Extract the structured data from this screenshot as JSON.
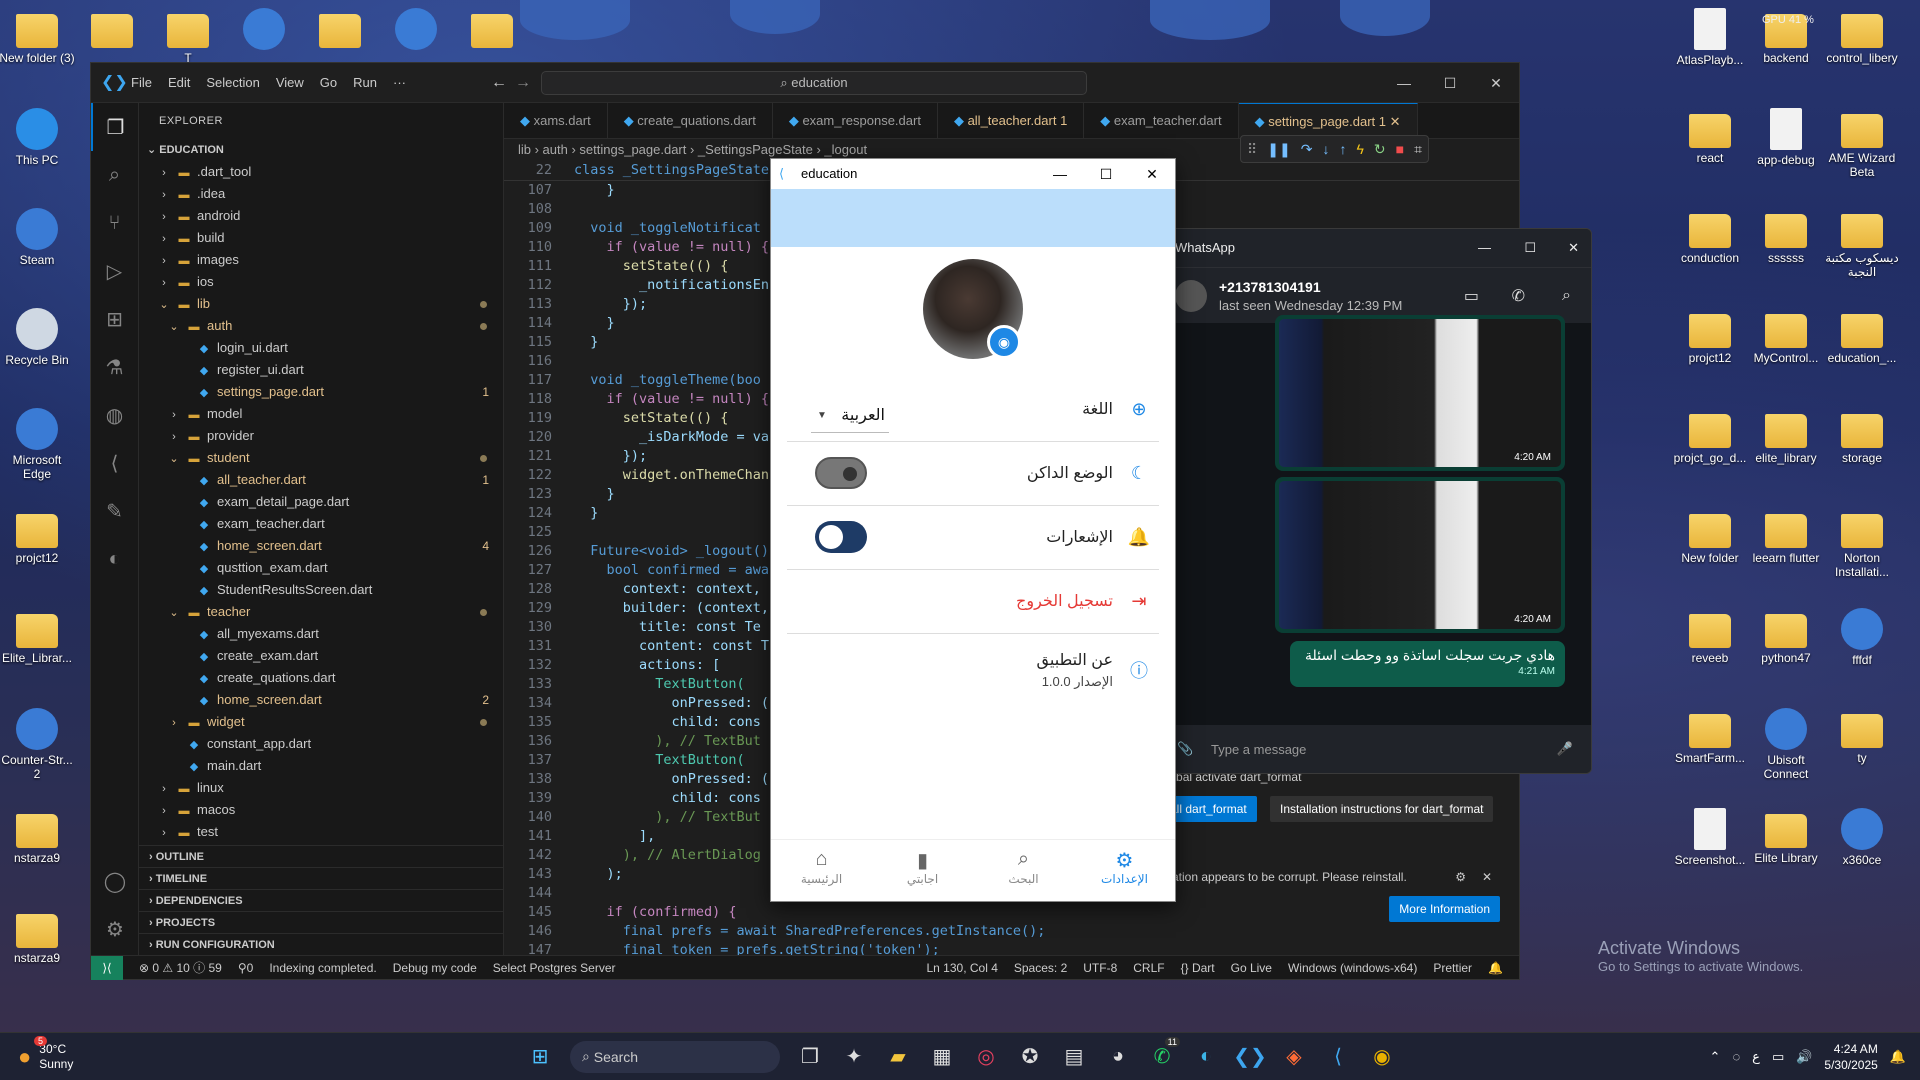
{
  "desktop": {
    "left_icons": [
      {
        "label": "New folder (3)",
        "type": "folder"
      },
      {
        "label": "This PC",
        "type": "pc"
      },
      {
        "label": "Steam",
        "type": "app"
      },
      {
        "label": "Recycle Bin",
        "type": "bin"
      },
      {
        "label": "Microsoft Edge",
        "type": "app"
      },
      {
        "label": "projct12",
        "type": "folder"
      },
      {
        "label": "Elite_Librar...",
        "type": "folder"
      },
      {
        "label": "Counter-Str... 2",
        "type": "app"
      },
      {
        "label": "nstarza9",
        "type": "folder"
      },
      {
        "label": "nstarza9",
        "type": "folder"
      }
    ],
    "top_icons": [
      {
        "label": "",
        "type": "folder"
      },
      {
        "label": "T",
        "type": "folder"
      },
      {
        "label": "",
        "type": "app"
      },
      {
        "label": "",
        "type": "folder"
      },
      {
        "label": "",
        "type": "app"
      },
      {
        "label": "",
        "type": "folder"
      }
    ],
    "right_icons": [
      {
        "label": "AtlasPlayb...",
        "type": "file"
      },
      {
        "label": "backend",
        "type": "folder"
      },
      {
        "label": "control_libery",
        "type": "folder"
      },
      {
        "label": "react",
        "type": "folder"
      },
      {
        "label": "app-debug",
        "type": "file"
      },
      {
        "label": "AME Wizard Beta",
        "type": "folder"
      },
      {
        "label": "conduction",
        "type": "folder"
      },
      {
        "label": "ssssss",
        "type": "folder"
      },
      {
        "label": "ديسكوب مكتبة النجبة",
        "type": "folder"
      },
      {
        "label": "projct12",
        "type": "folder"
      },
      {
        "label": "MyControl...",
        "type": "folder"
      },
      {
        "label": "education_...",
        "type": "folder"
      },
      {
        "label": "projct_go_d...",
        "type": "folder"
      },
      {
        "label": "elite_library",
        "type": "folder"
      },
      {
        "label": "storage",
        "type": "folder"
      },
      {
        "label": "New folder",
        "type": "folder"
      },
      {
        "label": "leearn flutter",
        "type": "folder"
      },
      {
        "label": "Norton Installati...",
        "type": "folder"
      },
      {
        "label": "reveeb",
        "type": "folder"
      },
      {
        "label": "python47",
        "type": "folder"
      },
      {
        "label": "fffdf",
        "type": "app"
      },
      {
        "label": "SmartFarm...",
        "type": "folder"
      },
      {
        "label": "Ubisoft Connect",
        "type": "app"
      },
      {
        "label": "ty",
        "type": "folder"
      },
      {
        "label": "Screenshot...",
        "type": "file"
      },
      {
        "label": "Elite Library",
        "type": "folder"
      },
      {
        "label": "x360ce",
        "type": "app"
      }
    ],
    "gpu": "GPU 41 %"
  },
  "vscode": {
    "menu": [
      "File",
      "Edit",
      "Selection",
      "View",
      "Go",
      "Run",
      "···"
    ],
    "search": "education",
    "explorer_title": "EXPLORER",
    "project": "EDUCATION",
    "tree": [
      {
        "label": ".dart_tool",
        "d": 1,
        "kind": "folder"
      },
      {
        "label": ".idea",
        "d": 1,
        "kind": "folder"
      },
      {
        "label": "android",
        "d": 1,
        "kind": "folder"
      },
      {
        "label": "build",
        "d": 1,
        "kind": "folder"
      },
      {
        "label": "images",
        "d": 1,
        "kind": "folder"
      },
      {
        "label": "ios",
        "d": 1,
        "kind": "folder"
      },
      {
        "label": "lib",
        "d": 1,
        "kind": "folder-open",
        "mod": true,
        "dot": true
      },
      {
        "label": "auth",
        "d": 2,
        "kind": "folder-open",
        "mod": true,
        "dot": true
      },
      {
        "label": "login_ui.dart",
        "d": 3,
        "kind": "dart"
      },
      {
        "label": "register_ui.dart",
        "d": 3,
        "kind": "dart"
      },
      {
        "label": "settings_page.dart",
        "d": 3,
        "kind": "dart",
        "mod": true,
        "badge": "1"
      },
      {
        "label": "model",
        "d": 2,
        "kind": "folder"
      },
      {
        "label": "provider",
        "d": 2,
        "kind": "folder"
      },
      {
        "label": "student",
        "d": 2,
        "kind": "folder-open",
        "mod": true,
        "dot": true
      },
      {
        "label": "all_teacher.dart",
        "d": 3,
        "kind": "dart",
        "mod": true,
        "badge": "1"
      },
      {
        "label": "exam_detail_page.dart",
        "d": 3,
        "kind": "dart"
      },
      {
        "label": "exam_teacher.dart",
        "d": 3,
        "kind": "dart"
      },
      {
        "label": "home_screen.dart",
        "d": 3,
        "kind": "dart",
        "mod": true,
        "badge": "4"
      },
      {
        "label": "qusttion_exam.dart",
        "d": 3,
        "kind": "dart"
      },
      {
        "label": "StudentResultsScreen.dart",
        "d": 3,
        "kind": "dart"
      },
      {
        "label": "teacher",
        "d": 2,
        "kind": "folder-open",
        "mod": true,
        "dot": true
      },
      {
        "label": "all_myexams.dart",
        "d": 3,
        "kind": "dart"
      },
      {
        "label": "create_exam.dart",
        "d": 3,
        "kind": "dart"
      },
      {
        "label": "create_quations.dart",
        "d": 3,
        "kind": "dart"
      },
      {
        "label": "home_screen.dart",
        "d": 3,
        "kind": "dart",
        "mod": true,
        "badge": "2"
      },
      {
        "label": "widget",
        "d": 2,
        "kind": "folder",
        "mod": true,
        "dot": true
      },
      {
        "label": "constant_app.dart",
        "d": 2,
        "kind": "dart"
      },
      {
        "label": "main.dart",
        "d": 2,
        "kind": "dart"
      },
      {
        "label": "linux",
        "d": 1,
        "kind": "folder"
      },
      {
        "label": "macos",
        "d": 1,
        "kind": "folder"
      },
      {
        "label": "test",
        "d": 1,
        "kind": "folder"
      }
    ],
    "sections": [
      "OUTLINE",
      "TIMELINE",
      "DEPENDENCIES",
      "PROJECTS",
      "RUN CONFIGURATION"
    ],
    "tabs": [
      {
        "label": "xams.dart"
      },
      {
        "label": "create_quations.dart"
      },
      {
        "label": "exam_response.dart"
      },
      {
        "label": "all_teacher.dart 1",
        "warn": true
      },
      {
        "label": "exam_teacher.dart"
      },
      {
        "label": "settings_page.dart 1",
        "warn": true,
        "active": true
      }
    ],
    "breadcrumb": "lib › auth › settings_page.dart › _SettingsPageState › _logout",
    "sticky": {
      "n": "22",
      "text": "class _SettingsPageState"
    },
    "code": [
      {
        "n": "107",
        "t": "    }"
      },
      {
        "n": "108",
        "t": ""
      },
      {
        "n": "109",
        "t": "  void _toggleNotificat"
      },
      {
        "n": "110",
        "t": "    if (value != null) {"
      },
      {
        "n": "111",
        "t": "      setState(() {"
      },
      {
        "n": "112",
        "t": "        _notificationsEn"
      },
      {
        "n": "113",
        "t": "      });"
      },
      {
        "n": "114",
        "t": "    }"
      },
      {
        "n": "115",
        "t": "  }"
      },
      {
        "n": "116",
        "t": ""
      },
      {
        "n": "117",
        "t": "  void _toggleTheme(boo"
      },
      {
        "n": "118",
        "t": "    if (value != null) {"
      },
      {
        "n": "119",
        "t": "      setState(() {"
      },
      {
        "n": "120",
        "t": "        _isDarkMode = va"
      },
      {
        "n": "121",
        "t": "      });"
      },
      {
        "n": "122",
        "t": "      widget.onThemeChan"
      },
      {
        "n": "123",
        "t": "    }"
      },
      {
        "n": "124",
        "t": "  }"
      },
      {
        "n": "125",
        "t": ""
      },
      {
        "n": "126",
        "t": "  Future<void> _logout()"
      },
      {
        "n": "127",
        "t": "    bool confirmed = awa"
      },
      {
        "n": "128",
        "t": "      context: context,"
      },
      {
        "n": "129",
        "t": "      builder: (context,"
      },
      {
        "n": "130",
        "t": "        title: const Te"
      },
      {
        "n": "131",
        "t": "        content: const T"
      },
      {
        "n": "132",
        "t": "        actions: ["
      },
      {
        "n": "133",
        "t": "          TextButton("
      },
      {
        "n": "134",
        "t": "            onPressed: ("
      },
      {
        "n": "135",
        "t": "            child: cons"
      },
      {
        "n": "136",
        "t": "          ), // TextBut"
      },
      {
        "n": "137",
        "t": "          TextButton("
      },
      {
        "n": "138",
        "t": "            onPressed: ("
      },
      {
        "n": "139",
        "t": "            child: cons"
      },
      {
        "n": "140",
        "t": "          ), // TextBut"
      },
      {
        "n": "141",
        "t": "        ],"
      },
      {
        "n": "142",
        "t": "      ), // AlertDialog"
      },
      {
        "n": "143",
        "t": "    );"
      },
      {
        "n": "144",
        "t": ""
      },
      {
        "n": "145",
        "t": "    if (confirmed) {"
      },
      {
        "n": "146",
        "t": "      final prefs = await SharedPreferences.getInstance();"
      },
      {
        "n": "147",
        "t": "      final token = prefs.getString('token');"
      }
    ],
    "status": {
      "problems": "⊗ 0 ⚠ 10 ⓘ 59",
      "ports": "⚲0",
      "indexing": "Indexing completed.",
      "debug": "Debug my code",
      "postgres": "Select Postgres Server",
      "pos": "Ln 130, Col 4",
      "spaces": "Spaces: 2",
      "enc": "UTF-8",
      "eol": "CRLF",
      "lang": "{} Dart",
      "live": "Go Live",
      "platform": "Windows (windows-x64)",
      "prettier": "Prettier"
    }
  },
  "whatsapp": {
    "title": "WhatsApp",
    "contact": "+213781304191",
    "last_seen": "last seen Wednesday 12:39 PM",
    "img1_time": "4:20 AM",
    "img2_time": "4:20 AM",
    "msg": "هادي جربت سجلت اساتذة وو وحطت اسئلة",
    "msg_time": "4:21 AM",
    "placeholder": "Type a message"
  },
  "format_note": {
    "text": "global activate dart_format",
    "btn1": "all dart_format",
    "btn2": "Installation instructions for dart_format",
    "warn": "allation appears to be corrupt. Please reinstall.",
    "btn3": "More Information"
  },
  "edu_app": {
    "title": "education",
    "language_label": "اللغة",
    "language_value": "العربية",
    "dark_mode": "الوضع الداكن",
    "notifications": "الإشعارات",
    "logout": "تسجيل الخروج",
    "about": "عن التطبيق",
    "version": "الإصدار 1.0.0",
    "dark_mode_on": false,
    "notifications_on": true,
    "nav": [
      {
        "label": "الإعدادات",
        "icon": "settings-icon",
        "selected": true
      },
      {
        "label": "البحث",
        "icon": "search-icon"
      },
      {
        "label": "اجابتي",
        "icon": "bookmark-icon"
      },
      {
        "label": "الرئيسية",
        "icon": "home-icon"
      }
    ],
    "accent": "#1e88e5",
    "appbar": "#bbdefb",
    "logout_color": "#e53935"
  },
  "activate": {
    "title": "Activate Windows",
    "sub": "Go to Settings to activate Windows."
  },
  "taskbar": {
    "weather_temp": "30°C",
    "weather_desc": "Sunny",
    "weather_badge": "5",
    "search": "Search",
    "time": "4:24 AM",
    "date": "5/30/2025",
    "lang": "ع",
    "wa_badge": "11"
  }
}
